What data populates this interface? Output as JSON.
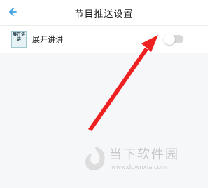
{
  "header": {
    "back_icon": "arrow-left-icon",
    "title": "节目推送设置"
  },
  "list": {
    "items": [
      {
        "icon": "app-book-icon",
        "icon_text": "展开讲讲",
        "label": "展开讲讲",
        "toggle": "off"
      }
    ]
  },
  "watermark": {
    "text": "当下软件园",
    "url": "www.downxia.com"
  },
  "colors": {
    "accent": "#3da0e0",
    "annotation_arrow": "#ee2020",
    "watermark": "#c8c8c8"
  }
}
